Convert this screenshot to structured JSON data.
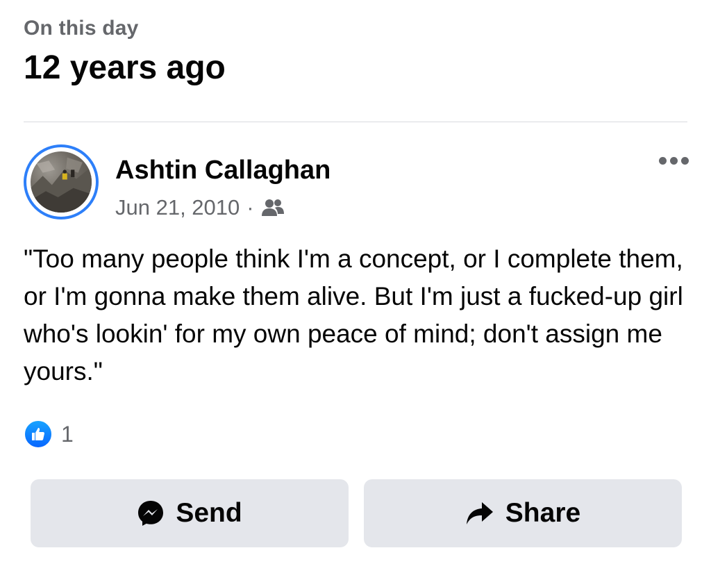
{
  "header": {
    "eyebrow": "On this day",
    "title": "12 years ago"
  },
  "post": {
    "author": "Ashtin Callaghan",
    "date": "Jun 21, 2010",
    "separator": "·",
    "audience_icon": "friends-icon",
    "text": "\"Too many people think I'm a concept, or I complete them, or I'm gonna make them alive. But I'm just a fucked-up girl who's lookin' for my own peace of mind; don't assign me yours.\"",
    "reaction_count": "1"
  },
  "actions": {
    "send_label": "Send",
    "share_label": "Share"
  },
  "colors": {
    "accent": "#0866ff",
    "avatar_ring": "#2d7ff9",
    "button_bg": "#e4e6eb",
    "muted_text": "#65676b"
  }
}
